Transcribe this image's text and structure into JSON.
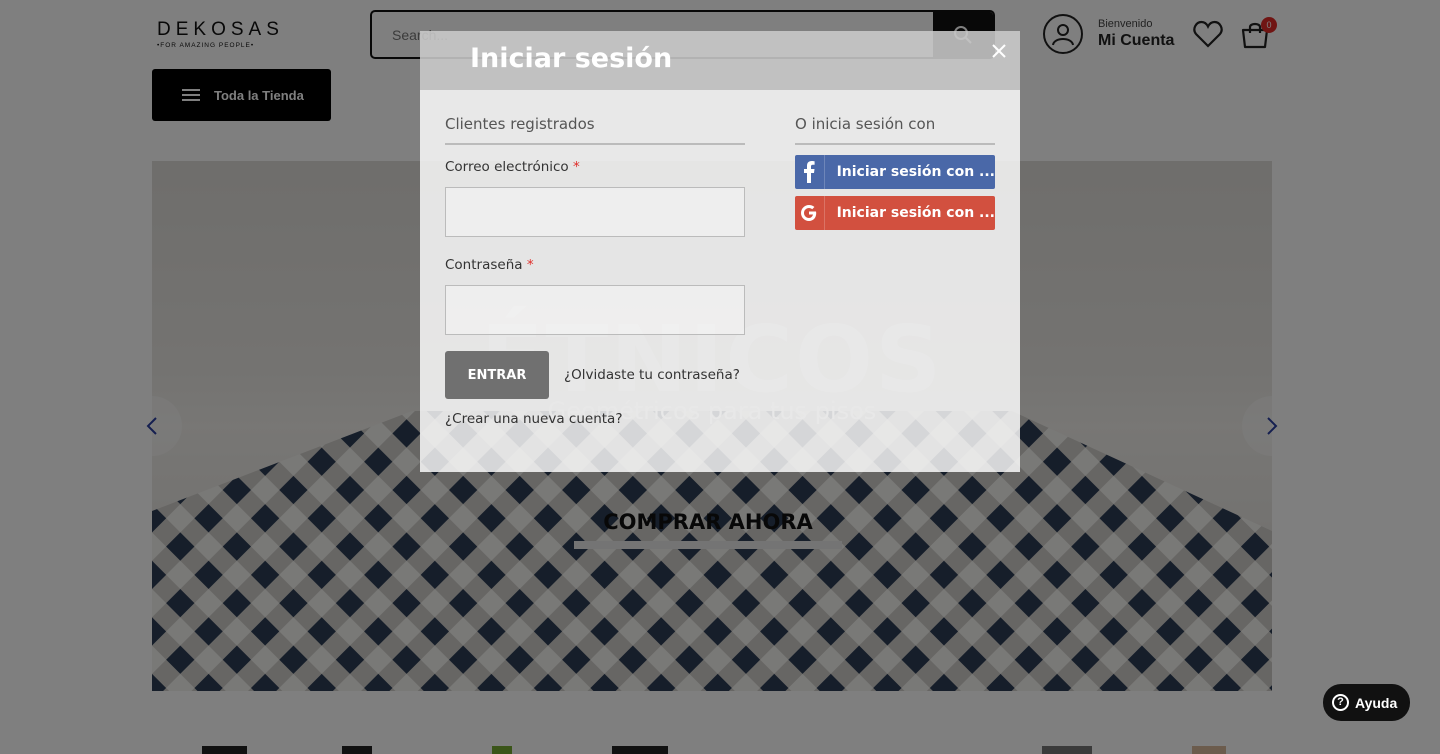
{
  "brand": {
    "name": "DEKOSAS",
    "tagline": "•FOR AMAZING PEOPLE•"
  },
  "search": {
    "placeholder": "Search..."
  },
  "account": {
    "greeting": "Bienvenido",
    "label": "Mi Cuenta"
  },
  "cart": {
    "count": "0"
  },
  "nav": {
    "store_label": "Toda la Tienda"
  },
  "hero": {
    "title": "ÉTNICOS",
    "subtitle": "Geométricos para tus pisos",
    "cta": "COMPRAR AHORA"
  },
  "modal": {
    "title": "Iniciar sesión",
    "registered_title": "Clientes registrados",
    "email_label": "Correo electrónico",
    "password_label": "Contraseña",
    "required_mark": "*",
    "login_button": "ENTRAR",
    "forgot_link": "¿Olvidaste tu contraseña?",
    "create_link": "¿Crear una nueva cuenta?",
    "social_title": "O inicia sesión con",
    "facebook_button": "Iniciar sesión con ...",
    "google_button": "Iniciar sesión con ..."
  },
  "help": {
    "label": "Ayuda"
  },
  "colors": {
    "facebook": "#4a68a8",
    "google": "#d2503f",
    "badge": "#e02b27",
    "arrow": "#2a3fa0"
  }
}
